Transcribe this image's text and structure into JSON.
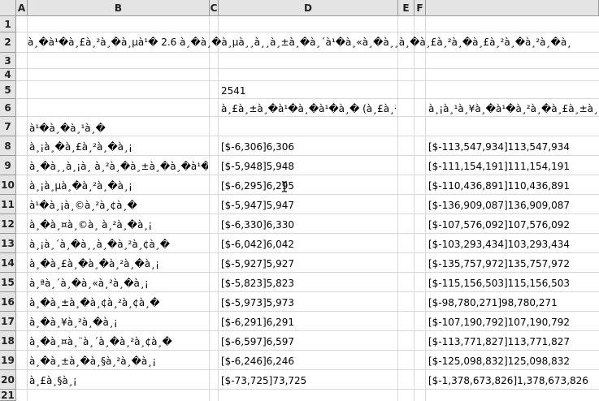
{
  "columns": [
    "A",
    "B",
    "C",
    "D",
    "E",
    "F"
  ],
  "rows": [
    "1",
    "2",
    "3",
    "4",
    "5",
    "6",
    "7",
    "8",
    "9",
    "10",
    "11",
    "12",
    "13",
    "14",
    "15",
    "16",
    "17",
    "18",
    "19",
    "20",
    "21"
  ],
  "title_text": "à¸�à¹�à¸£à¸²à¸�à¸µà¹� 2.6 à¸�à¸�à¸µà¸¸à¸¸à¸±à¸�à¸´à¹�à¸«à¸�à¸¸à¸�à¸£à¸²à¸�à¸£à¸²à¸�à¸²à¸�à¸",
  "year": "2541",
  "col_d_header": "à¸£à¸±à¸�à¹�à¸�à¹�à¸� (à¸£à¸²à¸¢)",
  "col_f_header": "à¸¡à¸¹à¸¥à¸�à¹�à¸²à¸�à¸£à¸±à¸",
  "row7_label": "à¹�à¸�à¸¹à¸�",
  "data_rows": [
    {
      "label": "à¸¡à¸�à¸£à¸²à¸�à¸¡",
      "units": "[$-6,306]6,306",
      "value": "[$-113,547,934]113,547,934"
    },
    {
      "label": "à¸�à¸¸à¸¡à¸ à¸²à¸�à¸±à¸�à¸�à¹�",
      "units": "[$-5,948]5,948",
      "value": "[$-111,154,191]111,154,191"
    },
    {
      "label": "à¸¡à¸µà¸�à¸²à¸�à¸¡",
      "units": "[$-6,295]6,295",
      "value": "[$-110,436,891]110,436,891"
    },
    {
      "label": "à¹�à¸¡à¸©à¸²à¸¢à¸�",
      "units": "[$-5,947]5,947",
      "value": "[$-136,909,087]136,909,087"
    },
    {
      "label": "à¸�à¸¤à¸©à¸ à¸²à¸�à¸¡",
      "units": "[$-6,330]6,330",
      "value": "[$-107,576,092]107,576,092"
    },
    {
      "label": "à¸¡à¸´à¸�à¸¸à¸�à¸²à¸¢à¸�",
      "units": "[$-6,042]6,042",
      "value": "[$-103,293,434]103,293,434"
    },
    {
      "label": "à¸�à¸£à¸�à¸�à¸²à¸�à¸¡",
      "units": "[$-5,927]5,927",
      "value": "[$-135,757,972]135,757,972"
    },
    {
      "label": "à¸ªà¸´à¸�à¸«à¸²à¸�à¸¡",
      "units": "[$-5,823]5,823",
      "value": "[$-115,156,503]115,156,503"
    },
    {
      "label": "à¸�à¸±à¸�à¸¢à¸²à¸¢à¸�",
      "units": "[$-5,973]5,973",
      "value": "[$-98,780,271]98,780,271"
    },
    {
      "label": "à¸�à¸¥à¸²à¸�à¸¡",
      "units": "[$-6,291]6,291",
      "value": "[$-107,190,792]107,190,792"
    },
    {
      "label": "à¸�à¸¤à¸¨à¸´à¸�à¸²à¸¢à¸�",
      "units": "[$-6,597]6,597",
      "value": "[$-113,771,827]113,771,827"
    },
    {
      "label": "à¸�à¸±à¸�à¸§à¸²à¸�à¸¡",
      "units": "[$-6,246]6,246",
      "value": "[$-125,098,832]125,098,832"
    },
    {
      "label": "à¸£à¸§à¸¡",
      "units": "[$-73,725]73,725",
      "value": "[$-1,378,673,826]1,378,673,826"
    }
  ]
}
